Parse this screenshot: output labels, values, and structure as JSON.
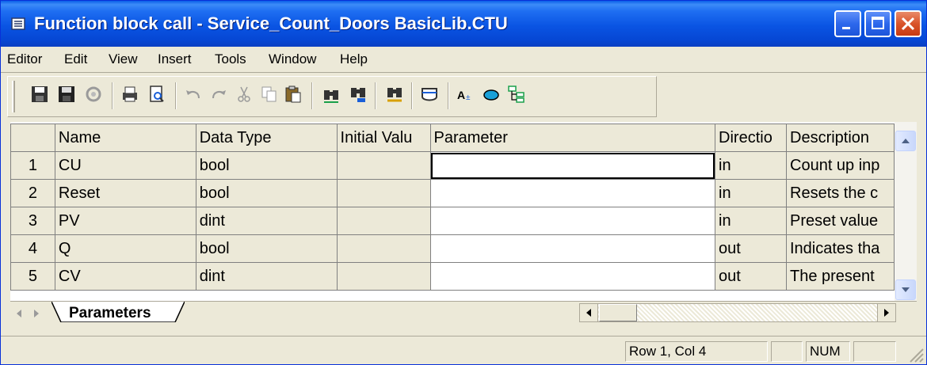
{
  "window": {
    "title": "Function block call - Service_Count_Doors BasicLib.CTU"
  },
  "menu": [
    "Editor",
    "Edit",
    "View",
    "Insert",
    "Tools",
    "Window",
    "Help"
  ],
  "toolbar": {
    "icons": [
      "save-icon",
      "save-all-icon",
      "compile-icon",
      "print-icon",
      "print-preview-icon",
      "undo-icon",
      "redo-icon",
      "cut-icon",
      "copy-icon",
      "paste-icon",
      "find-icon",
      "find-next-icon",
      "replace-icon",
      "insert-row-icon",
      "text-icon",
      "ellipse-icon",
      "hierarchy-icon"
    ]
  },
  "grid": {
    "columns": [
      "Name",
      "Data Type",
      "Initial Valu",
      "Parameter",
      "Directio",
      "Description"
    ],
    "rows": [
      {
        "num": "1",
        "name": "CU",
        "type": "bool",
        "initial": "",
        "param": "",
        "direction": "in",
        "description": "Count up inp"
      },
      {
        "num": "2",
        "name": "Reset",
        "type": "bool",
        "initial": "",
        "param": "",
        "direction": "in",
        "description": "Resets the c"
      },
      {
        "num": "3",
        "name": "PV",
        "type": "dint",
        "initial": "",
        "param": "",
        "direction": "in",
        "description": "Preset value"
      },
      {
        "num": "4",
        "name": "Q",
        "type": "bool",
        "initial": "",
        "param": "",
        "direction": "out",
        "description": "Indicates tha"
      },
      {
        "num": "5",
        "name": "CV",
        "type": "dint",
        "initial": "",
        "param": "",
        "direction": "out",
        "description": "The present"
      }
    ]
  },
  "tabs": {
    "active": "Parameters"
  },
  "status": {
    "position": "Row 1, Col 4",
    "num": "NUM"
  },
  "colors": {
    "titlebar": "#0a54e3",
    "close": "#c63a12",
    "face": "#ece9d8"
  }
}
